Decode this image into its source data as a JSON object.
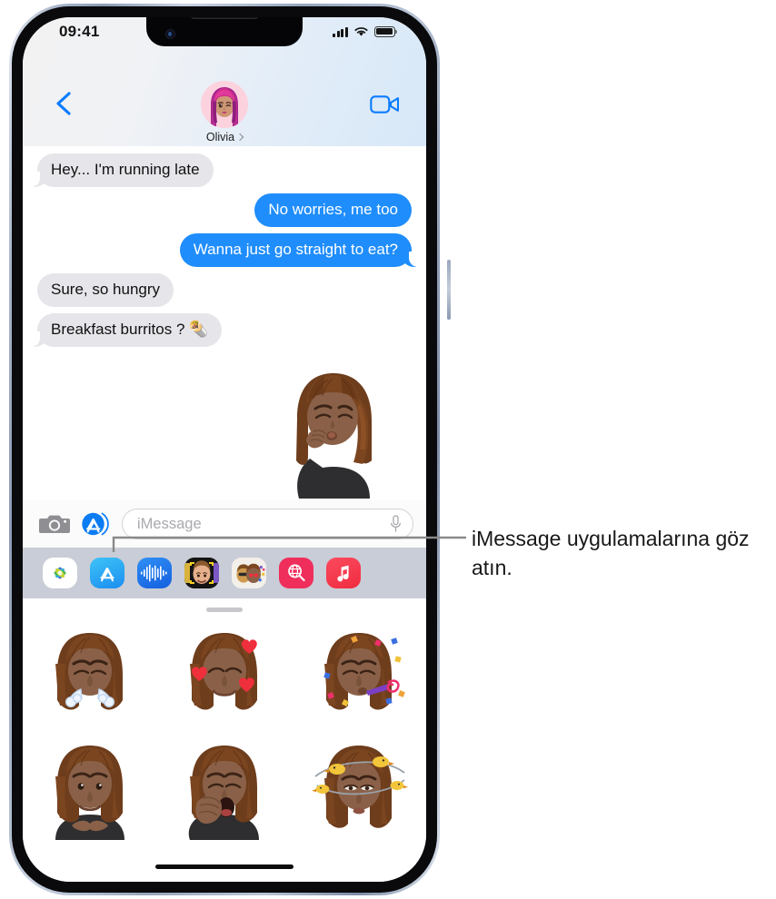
{
  "device": {
    "name": "iphone-13",
    "frame_color": "#9aa7bd",
    "screen_bg": "#ffffff"
  },
  "status_bar": {
    "time": "09:41",
    "signal_icon": "cellular-bars-icon",
    "signal_bars": 4,
    "wifi_icon": "wifi-icon",
    "battery_icon": "battery-icon",
    "battery_level": 80
  },
  "header": {
    "back_icon": "chevron-left-icon",
    "contact_name": "Olivia",
    "contact_chevron_icon": "chevron-right-icon",
    "avatar_name": "olivia-memoji-avatar",
    "facetime_icon": "video-camera-icon",
    "gradient_from": "#f2f2f2",
    "gradient_to": "#d7e8f8"
  },
  "conversation": {
    "messages": [
      {
        "id": "m1",
        "text": "Hey... I'm running late",
        "side": "in",
        "tail": true
      },
      {
        "id": "m2",
        "text": "No worries, me too",
        "side": "out",
        "tail": false
      },
      {
        "id": "m3",
        "text": "Wanna just go straight to eat?",
        "side": "out",
        "tail": true
      },
      {
        "id": "m4",
        "text": "Sure, so hungry",
        "side": "in",
        "tail": false
      },
      {
        "id": "m5",
        "text": "Breakfast burritos ? 🌯",
        "side": "in",
        "tail": true
      }
    ],
    "sent_sticker": "memoji-sticker-kiss",
    "incoming_bubble_color": "#e6e6ea",
    "outgoing_bubble_color": "#1f8dfb",
    "incoming_text_color": "#111112",
    "outgoing_text_color": "#ffffff"
  },
  "input_bar": {
    "camera_icon": "camera-icon",
    "appstore_icon": "app-store-icon",
    "placeholder": "iMessage",
    "value": "",
    "mic_icon": "microphone-icon"
  },
  "app_drawer": {
    "background": "#c9cdd7",
    "apps": [
      {
        "id": "a1",
        "name": "photos-app-icon",
        "label": "Photos",
        "selected": false
      },
      {
        "id": "a2",
        "name": "app-store-app-icon",
        "label": "App Store",
        "selected": false
      },
      {
        "id": "a3",
        "name": "audio-app-icon",
        "label": "Audio",
        "selected": false
      },
      {
        "id": "a4",
        "name": "memoji-app-icon",
        "label": "Memoji",
        "selected": false
      },
      {
        "id": "a5",
        "name": "stickers-app-icon",
        "label": "Stickers",
        "selected": true
      },
      {
        "id": "a6",
        "name": "images-gif-app-icon",
        "label": "#images",
        "selected": false
      },
      {
        "id": "a7",
        "name": "music-app-icon",
        "label": "Music",
        "selected": false
      }
    ]
  },
  "sticker_panel": {
    "grabber_icon": "drag-handle-icon",
    "stickers": [
      {
        "id": "s1",
        "name": "memoji-sticker-steam-nose",
        "label": "Steam from nose"
      },
      {
        "id": "s2",
        "name": "memoji-sticker-hearts",
        "label": "Hearts"
      },
      {
        "id": "s3",
        "name": "memoji-sticker-party",
        "label": "Party horn"
      },
      {
        "id": "s4",
        "name": "memoji-sticker-smile",
        "label": "Smiling"
      },
      {
        "id": "s5",
        "name": "memoji-sticker-yawn",
        "label": "Yawning"
      },
      {
        "id": "s6",
        "name": "memoji-sticker-dizzy-birds",
        "label": "Dizzy birds"
      }
    ],
    "home_indicator": "home-indicator"
  },
  "callout": {
    "text": "iMessage uygulamalarına göz atın.",
    "line_color": "#8a8a8a",
    "text_color": "#181818"
  }
}
